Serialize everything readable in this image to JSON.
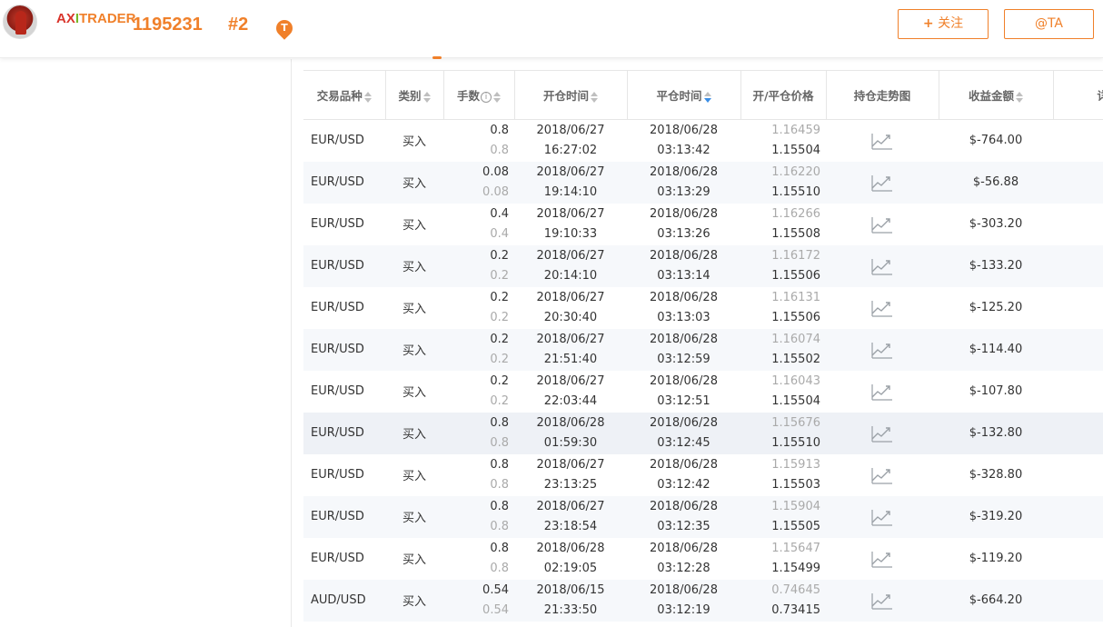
{
  "header": {
    "brand_ax": "AX",
    "brand_i": "I",
    "brand_rest": "TRADER",
    "account_id": "1195231",
    "rank": "#2",
    "badge_letter": "T",
    "follow_label": "关注",
    "follow_icon": "plus-icon",
    "ta_label": "@TA"
  },
  "table": {
    "columns": [
      "交易品种",
      "类别",
      "手数",
      "开仓时间",
      "平仓时间",
      "开/平仓价格",
      "持仓走势图",
      "收益金额",
      "详"
    ],
    "rows": [
      {
        "symbol": "EUR/USD",
        "type": "买入",
        "lots": "0.8",
        "lots_closed": "0.8",
        "open_date": "2018/06/27",
        "open_time": "16:27:02",
        "close_date": "2018/06/28",
        "close_time": "03:13:42",
        "open_price": "1.16459",
        "close_price": "1.15504",
        "profit": "$-764.00"
      },
      {
        "symbol": "EUR/USD",
        "type": "买入",
        "lots": "0.08",
        "lots_closed": "0.08",
        "open_date": "2018/06/27",
        "open_time": "19:14:10",
        "close_date": "2018/06/28",
        "close_time": "03:13:29",
        "open_price": "1.16220",
        "close_price": "1.15510",
        "profit": "$-56.88"
      },
      {
        "symbol": "EUR/USD",
        "type": "买入",
        "lots": "0.4",
        "lots_closed": "0.4",
        "open_date": "2018/06/27",
        "open_time": "19:10:33",
        "close_date": "2018/06/28",
        "close_time": "03:13:26",
        "open_price": "1.16266",
        "close_price": "1.15508",
        "profit": "$-303.20"
      },
      {
        "symbol": "EUR/USD",
        "type": "买入",
        "lots": "0.2",
        "lots_closed": "0.2",
        "open_date": "2018/06/27",
        "open_time": "20:14:10",
        "close_date": "2018/06/28",
        "close_time": "03:13:14",
        "open_price": "1.16172",
        "close_price": "1.15506",
        "profit": "$-133.20"
      },
      {
        "symbol": "EUR/USD",
        "type": "买入",
        "lots": "0.2",
        "lots_closed": "0.2",
        "open_date": "2018/06/27",
        "open_time": "20:30:40",
        "close_date": "2018/06/28",
        "close_time": "03:13:03",
        "open_price": "1.16131",
        "close_price": "1.15506",
        "profit": "$-125.20"
      },
      {
        "symbol": "EUR/USD",
        "type": "买入",
        "lots": "0.2",
        "lots_closed": "0.2",
        "open_date": "2018/06/27",
        "open_time": "21:51:40",
        "close_date": "2018/06/28",
        "close_time": "03:12:59",
        "open_price": "1.16074",
        "close_price": "1.15502",
        "profit": "$-114.40"
      },
      {
        "symbol": "EUR/USD",
        "type": "买入",
        "lots": "0.2",
        "lots_closed": "0.2",
        "open_date": "2018/06/27",
        "open_time": "22:03:44",
        "close_date": "2018/06/28",
        "close_time": "03:12:51",
        "open_price": "1.16043",
        "close_price": "1.15504",
        "profit": "$-107.80"
      },
      {
        "symbol": "EUR/USD",
        "type": "买入",
        "lots": "0.8",
        "lots_closed": "0.8",
        "open_date": "2018/06/28",
        "open_time": "01:59:30",
        "close_date": "2018/06/28",
        "close_time": "03:12:45",
        "open_price": "1.15676",
        "close_price": "1.15510",
        "profit": "$-132.80"
      },
      {
        "symbol": "EUR/USD",
        "type": "买入",
        "lots": "0.8",
        "lots_closed": "0.8",
        "open_date": "2018/06/27",
        "open_time": "23:13:25",
        "close_date": "2018/06/28",
        "close_time": "03:12:42",
        "open_price": "1.15913",
        "close_price": "1.15503",
        "profit": "$-328.80"
      },
      {
        "symbol": "EUR/USD",
        "type": "买入",
        "lots": "0.8",
        "lots_closed": "0.8",
        "open_date": "2018/06/27",
        "open_time": "23:18:54",
        "close_date": "2018/06/28",
        "close_time": "03:12:35",
        "open_price": "1.15904",
        "close_price": "1.15505",
        "profit": "$-319.20"
      },
      {
        "symbol": "EUR/USD",
        "type": "买入",
        "lots": "0.8",
        "lots_closed": "0.8",
        "open_date": "2018/06/28",
        "open_time": "02:19:05",
        "close_date": "2018/06/28",
        "close_time": "03:12:28",
        "open_price": "1.15647",
        "close_price": "1.15499",
        "profit": "$-119.20"
      },
      {
        "symbol": "AUD/USD",
        "type": "买入",
        "lots": "0.54",
        "lots_closed": "0.54",
        "open_date": "2018/06/15",
        "open_time": "21:33:50",
        "close_date": "2018/06/28",
        "close_time": "03:12:19",
        "open_price": "0.74645",
        "close_price": "0.73415",
        "profit": "$-664.20"
      }
    ],
    "trend_icon": "trend-chart-icon",
    "sorted_column": "平仓时间",
    "sort_direction": "desc",
    "accent_color": "#f0802a"
  }
}
